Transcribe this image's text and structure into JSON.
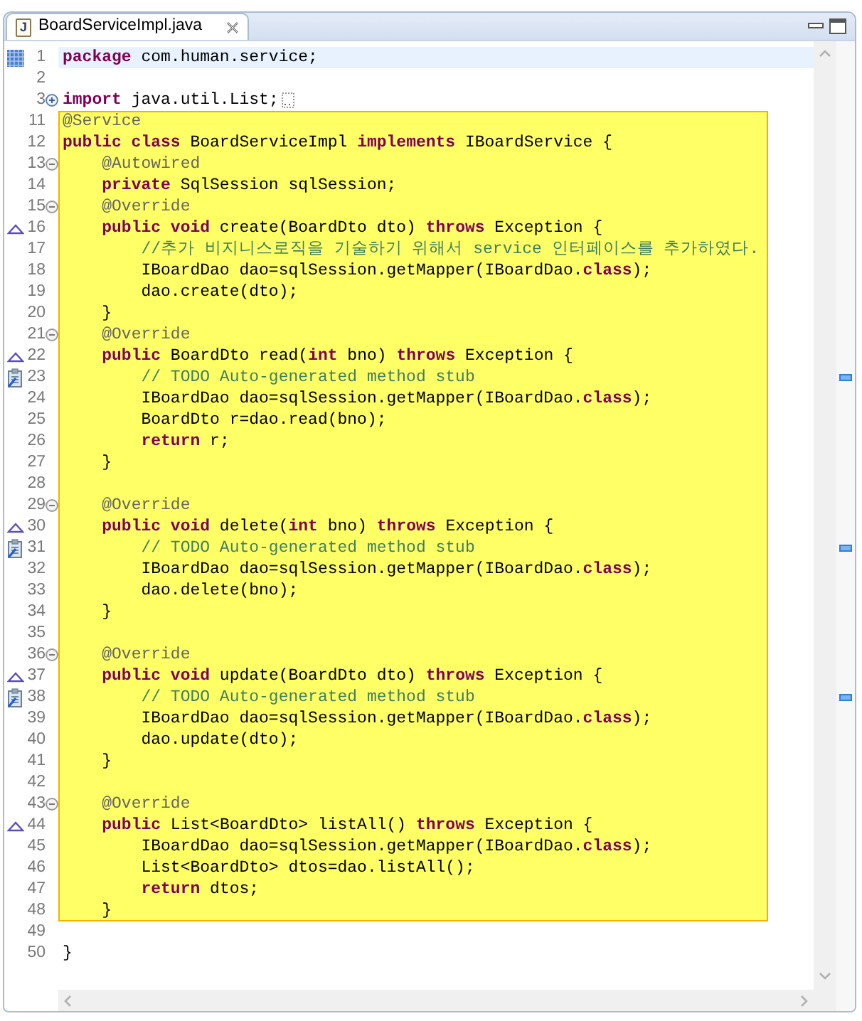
{
  "tab": {
    "icon_letter": "J",
    "title": "BoardServiceImpl.java",
    "selected": true
  },
  "lines": [
    {
      "number": "1",
      "ruler_marker": {
        "kind": "range"
      },
      "current": true,
      "highlighted": false,
      "tokens": [
        {
          "kind": "keyword",
          "text": "package"
        },
        {
          "kind": "plain",
          "text": " com.human.service;"
        }
      ]
    },
    {
      "number": "2",
      "current": false,
      "highlighted": false
    },
    {
      "number": "3",
      "fold_marker": {
        "kind": "expand"
      },
      "current": false,
      "highlighted": false,
      "tokens": [
        {
          "kind": "keyword",
          "text": "import"
        },
        {
          "kind": "plain",
          "text": " java.util.List;"
        }
      ]
    },
    {
      "number": "11",
      "current": false,
      "highlighted": true,
      "tokens": [
        {
          "kind": "annotation",
          "text": "@Service"
        }
      ]
    },
    {
      "number": "12",
      "current": false,
      "highlighted": true,
      "tokens": [
        {
          "kind": "keyword",
          "text": "public class"
        },
        {
          "kind": "plain",
          "text": " BoardServiceImpl "
        },
        {
          "kind": "keyword",
          "text": "implements"
        },
        {
          "kind": "plain",
          "text": " IBoardService {"
        }
      ]
    },
    {
      "number": "13",
      "fold_marker": {
        "kind": "collapse"
      },
      "current": false,
      "highlighted": true,
      "tokens": [
        {
          "kind": "annotation",
          "text": "    @Autowired"
        }
      ]
    },
    {
      "number": "14",
      "current": false,
      "highlighted": true,
      "tokens": [
        {
          "kind": "keyword",
          "text": "    private"
        },
        {
          "kind": "plain",
          "text": " SqlSession sqlSession;"
        }
      ]
    },
    {
      "number": "15",
      "fold_marker": {
        "kind": "collapse"
      },
      "current": false,
      "highlighted": true,
      "tokens": [
        {
          "kind": "annotation",
          "text": "    @Override"
        }
      ]
    },
    {
      "number": "16",
      "ruler_marker": {
        "kind": "override"
      },
      "current": false,
      "highlighted": true,
      "tokens": [
        {
          "kind": "keyword",
          "text": "    public void"
        },
        {
          "kind": "plain",
          "text": " create(BoardDto dto) "
        },
        {
          "kind": "keyword",
          "text": "throws"
        },
        {
          "kind": "plain",
          "text": " Exception {"
        }
      ]
    },
    {
      "number": "17",
      "current": false,
      "highlighted": true,
      "tokens": [
        {
          "kind": "comment",
          "text": "        //추가 비지니스로직을 기술하기 위해서 service 인터페이스를 추가하였다."
        }
      ]
    },
    {
      "number": "18",
      "current": false,
      "highlighted": true,
      "tokens": [
        {
          "kind": "plain",
          "text": "        IBoardDao dao=sqlSession.getMapper(IBoardDao."
        },
        {
          "kind": "keyword",
          "text": "class"
        },
        {
          "kind": "plain",
          "text": ");"
        }
      ]
    },
    {
      "number": "19",
      "current": false,
      "highlighted": true,
      "tokens": [
        {
          "kind": "plain",
          "text": "        dao.create(dto);"
        }
      ]
    },
    {
      "number": "20",
      "current": false,
      "highlighted": true,
      "tokens": [
        {
          "kind": "plain",
          "text": "    }"
        }
      ]
    },
    {
      "number": "21",
      "fold_marker": {
        "kind": "collapse"
      },
      "current": false,
      "highlighted": true,
      "tokens": [
        {
          "kind": "annotation",
          "text": "    @Override"
        }
      ]
    },
    {
      "number": "22",
      "ruler_marker": {
        "kind": "override"
      },
      "current": false,
      "highlighted": true,
      "tokens": [
        {
          "kind": "keyword",
          "text": "    public"
        },
        {
          "kind": "plain",
          "text": " BoardDto read("
        },
        {
          "kind": "keyword",
          "text": "int"
        },
        {
          "kind": "plain",
          "text": " bno) "
        },
        {
          "kind": "keyword",
          "text": "throws"
        },
        {
          "kind": "plain",
          "text": " Exception {"
        }
      ]
    },
    {
      "number": "23",
      "ruler_marker": {
        "kind": "task"
      },
      "current": false,
      "highlighted": true,
      "tokens": [
        {
          "kind": "comment",
          "text": "        // TODO Auto-generated method stub"
        }
      ]
    },
    {
      "number": "24",
      "current": false,
      "highlighted": true,
      "tokens": [
        {
          "kind": "plain",
          "text": "        IBoardDao dao=sqlSession.getMapper(IBoardDao."
        },
        {
          "kind": "keyword",
          "text": "class"
        },
        {
          "kind": "plain",
          "text": ");"
        }
      ]
    },
    {
      "number": "25",
      "current": false,
      "highlighted": true,
      "tokens": [
        {
          "kind": "plain",
          "text": "        BoardDto r=dao.read(bno);"
        }
      ]
    },
    {
      "number": "26",
      "current": false,
      "highlighted": true,
      "tokens": [
        {
          "kind": "keyword",
          "text": "        return"
        },
        {
          "kind": "plain",
          "text": " r;"
        }
      ]
    },
    {
      "number": "27",
      "current": false,
      "highlighted": true,
      "tokens": [
        {
          "kind": "plain",
          "text": "    }"
        }
      ]
    },
    {
      "number": "28",
      "current": false,
      "highlighted": true
    },
    {
      "number": "29",
      "fold_marker": {
        "kind": "collapse"
      },
      "current": false,
      "highlighted": true,
      "tokens": [
        {
          "kind": "annotation",
          "text": "    @Override"
        }
      ]
    },
    {
      "number": "30",
      "ruler_marker": {
        "kind": "override"
      },
      "current": false,
      "highlighted": true,
      "tokens": [
        {
          "kind": "keyword",
          "text": "    public void"
        },
        {
          "kind": "plain",
          "text": " delete("
        },
        {
          "kind": "keyword",
          "text": "int"
        },
        {
          "kind": "plain",
          "text": " bno) "
        },
        {
          "kind": "keyword",
          "text": "throws"
        },
        {
          "kind": "plain",
          "text": " Exception {"
        }
      ]
    },
    {
      "number": "31",
      "ruler_marker": {
        "kind": "task"
      },
      "current": false,
      "highlighted": true,
      "tokens": [
        {
          "kind": "comment",
          "text": "        // TODO Auto-generated method stub"
        }
      ]
    },
    {
      "number": "32",
      "current": false,
      "highlighted": true,
      "tokens": [
        {
          "kind": "plain",
          "text": "        IBoardDao dao=sqlSession.getMapper(IBoardDao."
        },
        {
          "kind": "keyword",
          "text": "class"
        },
        {
          "kind": "plain",
          "text": ");"
        }
      ]
    },
    {
      "number": "33",
      "current": false,
      "highlighted": true,
      "tokens": [
        {
          "kind": "plain",
          "text": "        dao.delete(bno);"
        }
      ]
    },
    {
      "number": "34",
      "current": false,
      "highlighted": true,
      "tokens": [
        {
          "kind": "plain",
          "text": "    }"
        }
      ]
    },
    {
      "number": "35",
      "current": false,
      "highlighted": true
    },
    {
      "number": "36",
      "fold_marker": {
        "kind": "collapse"
      },
      "current": false,
      "highlighted": true,
      "tokens": [
        {
          "kind": "annotation",
          "text": "    @Override"
        }
      ]
    },
    {
      "number": "37",
      "ruler_marker": {
        "kind": "override"
      },
      "current": false,
      "highlighted": true,
      "tokens": [
        {
          "kind": "keyword",
          "text": "    public void"
        },
        {
          "kind": "plain",
          "text": " update(BoardDto dto) "
        },
        {
          "kind": "keyword",
          "text": "throws"
        },
        {
          "kind": "plain",
          "text": " Exception {"
        }
      ]
    },
    {
      "number": "38",
      "ruler_marker": {
        "kind": "task"
      },
      "current": false,
      "highlighted": true,
      "tokens": [
        {
          "kind": "comment",
          "text": "        // TODO Auto-generated method stub"
        }
      ]
    },
    {
      "number": "39",
      "current": false,
      "highlighted": true,
      "tokens": [
        {
          "kind": "plain",
          "text": "        IBoardDao dao=sqlSession.getMapper(IBoardDao."
        },
        {
          "kind": "keyword",
          "text": "class"
        },
        {
          "kind": "plain",
          "text": ");"
        }
      ]
    },
    {
      "number": "40",
      "current": false,
      "highlighted": true,
      "tokens": [
        {
          "kind": "plain",
          "text": "        dao.update(dto);"
        }
      ]
    },
    {
      "number": "41",
      "current": false,
      "highlighted": true,
      "tokens": [
        {
          "kind": "plain",
          "text": "    }"
        }
      ]
    },
    {
      "number": "42",
      "current": false,
      "highlighted": true
    },
    {
      "number": "43",
      "fold_marker": {
        "kind": "collapse"
      },
      "current": false,
      "highlighted": true,
      "tokens": [
        {
          "kind": "annotation",
          "text": "    @Override"
        }
      ]
    },
    {
      "number": "44",
      "ruler_marker": {
        "kind": "override"
      },
      "current": false,
      "highlighted": true,
      "tokens": [
        {
          "kind": "keyword",
          "text": "    public"
        },
        {
          "kind": "plain",
          "text": " List<BoardDto> listAll() "
        },
        {
          "kind": "keyword",
          "text": "throws"
        },
        {
          "kind": "plain",
          "text": " Exception {"
        }
      ]
    },
    {
      "number": "45",
      "current": false,
      "highlighted": true,
      "tokens": [
        {
          "kind": "plain",
          "text": "        IBoardDao dao=sqlSession.getMapper(IBoardDao."
        },
        {
          "kind": "keyword",
          "text": "class"
        },
        {
          "kind": "plain",
          "text": ");"
        }
      ]
    },
    {
      "number": "46",
      "current": false,
      "highlighted": true,
      "tokens": [
        {
          "kind": "plain",
          "text": "        List<BoardDto> dtos=dao.listAll();"
        }
      ]
    },
    {
      "number": "47",
      "current": false,
      "highlighted": true,
      "tokens": [
        {
          "kind": "keyword",
          "text": "        return"
        },
        {
          "kind": "plain",
          "text": " dtos;"
        }
      ]
    },
    {
      "number": "48",
      "current": false,
      "highlighted": true,
      "tokens": [
        {
          "kind": "plain",
          "text": "    }"
        }
      ]
    },
    {
      "number": "49",
      "current": false,
      "highlighted": false
    },
    {
      "number": "50",
      "current": false,
      "highlighted": false,
      "tokens": [
        {
          "kind": "plain",
          "text": "}"
        }
      ]
    }
  ]
}
